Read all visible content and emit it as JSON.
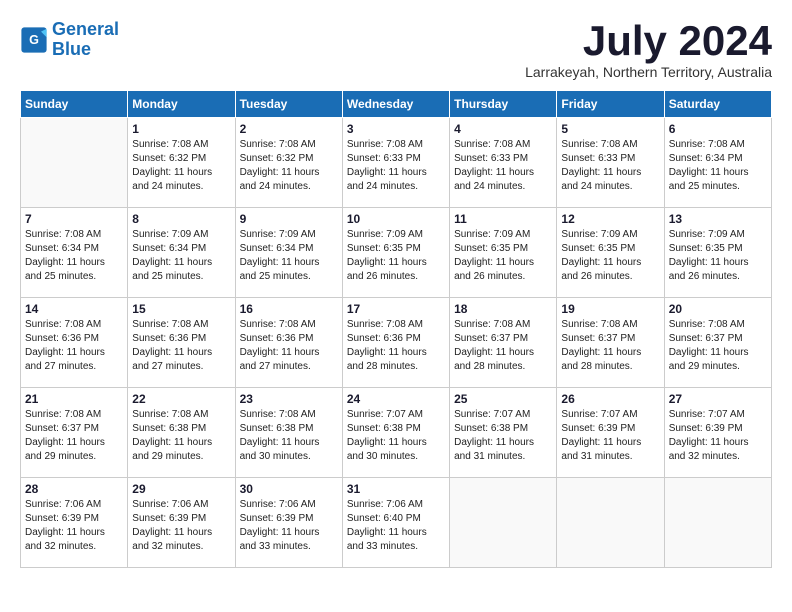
{
  "header": {
    "logo_line1": "General",
    "logo_line2": "Blue",
    "month_year": "July 2024",
    "location": "Larrakeyah, Northern Territory, Australia"
  },
  "days_of_week": [
    "Sunday",
    "Monday",
    "Tuesday",
    "Wednesday",
    "Thursday",
    "Friday",
    "Saturday"
  ],
  "weeks": [
    [
      {
        "day": "",
        "info": ""
      },
      {
        "day": "1",
        "info": "Sunrise: 7:08 AM\nSunset: 6:32 PM\nDaylight: 11 hours\nand 24 minutes."
      },
      {
        "day": "2",
        "info": "Sunrise: 7:08 AM\nSunset: 6:32 PM\nDaylight: 11 hours\nand 24 minutes."
      },
      {
        "day": "3",
        "info": "Sunrise: 7:08 AM\nSunset: 6:33 PM\nDaylight: 11 hours\nand 24 minutes."
      },
      {
        "day": "4",
        "info": "Sunrise: 7:08 AM\nSunset: 6:33 PM\nDaylight: 11 hours\nand 24 minutes."
      },
      {
        "day": "5",
        "info": "Sunrise: 7:08 AM\nSunset: 6:33 PM\nDaylight: 11 hours\nand 24 minutes."
      },
      {
        "day": "6",
        "info": "Sunrise: 7:08 AM\nSunset: 6:34 PM\nDaylight: 11 hours\nand 25 minutes."
      }
    ],
    [
      {
        "day": "7",
        "info": "Sunrise: 7:08 AM\nSunset: 6:34 PM\nDaylight: 11 hours\nand 25 minutes."
      },
      {
        "day": "8",
        "info": "Sunrise: 7:09 AM\nSunset: 6:34 PM\nDaylight: 11 hours\nand 25 minutes."
      },
      {
        "day": "9",
        "info": "Sunrise: 7:09 AM\nSunset: 6:34 PM\nDaylight: 11 hours\nand 25 minutes."
      },
      {
        "day": "10",
        "info": "Sunrise: 7:09 AM\nSunset: 6:35 PM\nDaylight: 11 hours\nand 26 minutes."
      },
      {
        "day": "11",
        "info": "Sunrise: 7:09 AM\nSunset: 6:35 PM\nDaylight: 11 hours\nand 26 minutes."
      },
      {
        "day": "12",
        "info": "Sunrise: 7:09 AM\nSunset: 6:35 PM\nDaylight: 11 hours\nand 26 minutes."
      },
      {
        "day": "13",
        "info": "Sunrise: 7:09 AM\nSunset: 6:35 PM\nDaylight: 11 hours\nand 26 minutes."
      }
    ],
    [
      {
        "day": "14",
        "info": "Sunrise: 7:08 AM\nSunset: 6:36 PM\nDaylight: 11 hours\nand 27 minutes."
      },
      {
        "day": "15",
        "info": "Sunrise: 7:08 AM\nSunset: 6:36 PM\nDaylight: 11 hours\nand 27 minutes."
      },
      {
        "day": "16",
        "info": "Sunrise: 7:08 AM\nSunset: 6:36 PM\nDaylight: 11 hours\nand 27 minutes."
      },
      {
        "day": "17",
        "info": "Sunrise: 7:08 AM\nSunset: 6:36 PM\nDaylight: 11 hours\nand 28 minutes."
      },
      {
        "day": "18",
        "info": "Sunrise: 7:08 AM\nSunset: 6:37 PM\nDaylight: 11 hours\nand 28 minutes."
      },
      {
        "day": "19",
        "info": "Sunrise: 7:08 AM\nSunset: 6:37 PM\nDaylight: 11 hours\nand 28 minutes."
      },
      {
        "day": "20",
        "info": "Sunrise: 7:08 AM\nSunset: 6:37 PM\nDaylight: 11 hours\nand 29 minutes."
      }
    ],
    [
      {
        "day": "21",
        "info": "Sunrise: 7:08 AM\nSunset: 6:37 PM\nDaylight: 11 hours\nand 29 minutes."
      },
      {
        "day": "22",
        "info": "Sunrise: 7:08 AM\nSunset: 6:38 PM\nDaylight: 11 hours\nand 29 minutes."
      },
      {
        "day": "23",
        "info": "Sunrise: 7:08 AM\nSunset: 6:38 PM\nDaylight: 11 hours\nand 30 minutes."
      },
      {
        "day": "24",
        "info": "Sunrise: 7:07 AM\nSunset: 6:38 PM\nDaylight: 11 hours\nand 30 minutes."
      },
      {
        "day": "25",
        "info": "Sunrise: 7:07 AM\nSunset: 6:38 PM\nDaylight: 11 hours\nand 31 minutes."
      },
      {
        "day": "26",
        "info": "Sunrise: 7:07 AM\nSunset: 6:39 PM\nDaylight: 11 hours\nand 31 minutes."
      },
      {
        "day": "27",
        "info": "Sunrise: 7:07 AM\nSunset: 6:39 PM\nDaylight: 11 hours\nand 32 minutes."
      }
    ],
    [
      {
        "day": "28",
        "info": "Sunrise: 7:06 AM\nSunset: 6:39 PM\nDaylight: 11 hours\nand 32 minutes."
      },
      {
        "day": "29",
        "info": "Sunrise: 7:06 AM\nSunset: 6:39 PM\nDaylight: 11 hours\nand 32 minutes."
      },
      {
        "day": "30",
        "info": "Sunrise: 7:06 AM\nSunset: 6:39 PM\nDaylight: 11 hours\nand 33 minutes."
      },
      {
        "day": "31",
        "info": "Sunrise: 7:06 AM\nSunset: 6:40 PM\nDaylight: 11 hours\nand 33 minutes."
      },
      {
        "day": "",
        "info": ""
      },
      {
        "day": "",
        "info": ""
      },
      {
        "day": "",
        "info": ""
      }
    ]
  ]
}
